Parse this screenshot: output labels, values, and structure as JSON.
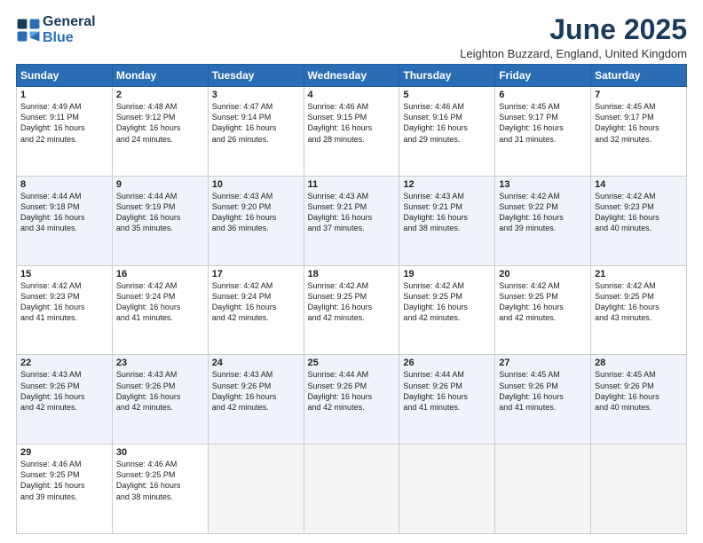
{
  "header": {
    "logo_line1": "General",
    "logo_line2": "Blue",
    "title": "June 2025",
    "location": "Leighton Buzzard, England, United Kingdom"
  },
  "weekdays": [
    "Sunday",
    "Monday",
    "Tuesday",
    "Wednesday",
    "Thursday",
    "Friday",
    "Saturday"
  ],
  "weeks": [
    [
      {
        "day": "1",
        "info": "Sunrise: 4:49 AM\nSunset: 9:11 PM\nDaylight: 16 hours\nand 22 minutes."
      },
      {
        "day": "2",
        "info": "Sunrise: 4:48 AM\nSunset: 9:12 PM\nDaylight: 16 hours\nand 24 minutes."
      },
      {
        "day": "3",
        "info": "Sunrise: 4:47 AM\nSunset: 9:14 PM\nDaylight: 16 hours\nand 26 minutes."
      },
      {
        "day": "4",
        "info": "Sunrise: 4:46 AM\nSunset: 9:15 PM\nDaylight: 16 hours\nand 28 minutes."
      },
      {
        "day": "5",
        "info": "Sunrise: 4:46 AM\nSunset: 9:16 PM\nDaylight: 16 hours\nand 29 minutes."
      },
      {
        "day": "6",
        "info": "Sunrise: 4:45 AM\nSunset: 9:17 PM\nDaylight: 16 hours\nand 31 minutes."
      },
      {
        "day": "7",
        "info": "Sunrise: 4:45 AM\nSunset: 9:17 PM\nDaylight: 16 hours\nand 32 minutes."
      }
    ],
    [
      {
        "day": "8",
        "info": "Sunrise: 4:44 AM\nSunset: 9:18 PM\nDaylight: 16 hours\nand 34 minutes."
      },
      {
        "day": "9",
        "info": "Sunrise: 4:44 AM\nSunset: 9:19 PM\nDaylight: 16 hours\nand 35 minutes."
      },
      {
        "day": "10",
        "info": "Sunrise: 4:43 AM\nSunset: 9:20 PM\nDaylight: 16 hours\nand 36 minutes."
      },
      {
        "day": "11",
        "info": "Sunrise: 4:43 AM\nSunset: 9:21 PM\nDaylight: 16 hours\nand 37 minutes."
      },
      {
        "day": "12",
        "info": "Sunrise: 4:43 AM\nSunset: 9:21 PM\nDaylight: 16 hours\nand 38 minutes."
      },
      {
        "day": "13",
        "info": "Sunrise: 4:42 AM\nSunset: 9:22 PM\nDaylight: 16 hours\nand 39 minutes."
      },
      {
        "day": "14",
        "info": "Sunrise: 4:42 AM\nSunset: 9:23 PM\nDaylight: 16 hours\nand 40 minutes."
      }
    ],
    [
      {
        "day": "15",
        "info": "Sunrise: 4:42 AM\nSunset: 9:23 PM\nDaylight: 16 hours\nand 41 minutes."
      },
      {
        "day": "16",
        "info": "Sunrise: 4:42 AM\nSunset: 9:24 PM\nDaylight: 16 hours\nand 41 minutes."
      },
      {
        "day": "17",
        "info": "Sunrise: 4:42 AM\nSunset: 9:24 PM\nDaylight: 16 hours\nand 42 minutes."
      },
      {
        "day": "18",
        "info": "Sunrise: 4:42 AM\nSunset: 9:25 PM\nDaylight: 16 hours\nand 42 minutes."
      },
      {
        "day": "19",
        "info": "Sunrise: 4:42 AM\nSunset: 9:25 PM\nDaylight: 16 hours\nand 42 minutes."
      },
      {
        "day": "20",
        "info": "Sunrise: 4:42 AM\nSunset: 9:25 PM\nDaylight: 16 hours\nand 42 minutes."
      },
      {
        "day": "21",
        "info": "Sunrise: 4:42 AM\nSunset: 9:25 PM\nDaylight: 16 hours\nand 43 minutes."
      }
    ],
    [
      {
        "day": "22",
        "info": "Sunrise: 4:43 AM\nSunset: 9:26 PM\nDaylight: 16 hours\nand 42 minutes."
      },
      {
        "day": "23",
        "info": "Sunrise: 4:43 AM\nSunset: 9:26 PM\nDaylight: 16 hours\nand 42 minutes."
      },
      {
        "day": "24",
        "info": "Sunrise: 4:43 AM\nSunset: 9:26 PM\nDaylight: 16 hours\nand 42 minutes."
      },
      {
        "day": "25",
        "info": "Sunrise: 4:44 AM\nSunset: 9:26 PM\nDaylight: 16 hours\nand 42 minutes."
      },
      {
        "day": "26",
        "info": "Sunrise: 4:44 AM\nSunset: 9:26 PM\nDaylight: 16 hours\nand 41 minutes."
      },
      {
        "day": "27",
        "info": "Sunrise: 4:45 AM\nSunset: 9:26 PM\nDaylight: 16 hours\nand 41 minutes."
      },
      {
        "day": "28",
        "info": "Sunrise: 4:45 AM\nSunset: 9:26 PM\nDaylight: 16 hours\nand 40 minutes."
      }
    ],
    [
      {
        "day": "29",
        "info": "Sunrise: 4:46 AM\nSunset: 9:25 PM\nDaylight: 16 hours\nand 39 minutes."
      },
      {
        "day": "30",
        "info": "Sunrise: 4:46 AM\nSunset: 9:25 PM\nDaylight: 16 hours\nand 38 minutes."
      },
      {
        "day": "",
        "info": ""
      },
      {
        "day": "",
        "info": ""
      },
      {
        "day": "",
        "info": ""
      },
      {
        "day": "",
        "info": ""
      },
      {
        "day": "",
        "info": ""
      }
    ]
  ]
}
